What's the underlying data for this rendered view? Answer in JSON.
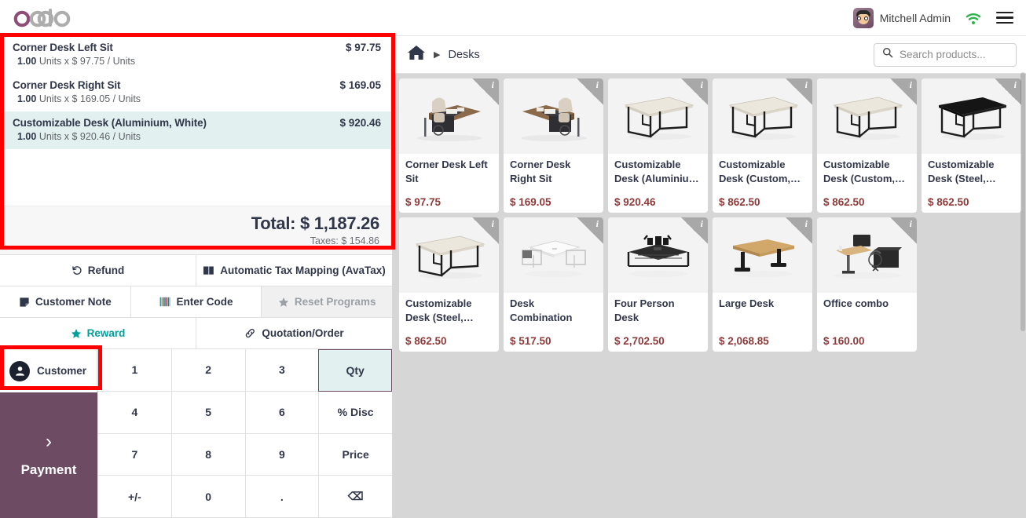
{
  "topbar": {
    "logo_text": "odoo",
    "user_name": "Mitchell Admin",
    "wifi_icon": "wifi-icon",
    "menu_icon": "hamburger-menu-icon",
    "avatar_name": "user-avatar"
  },
  "order": {
    "lines": [
      {
        "name": "Corner Desk Left Sit",
        "price": "$ 97.75",
        "qty": "1.00",
        "detail": "Units x $ 97.75 / Units",
        "selected": false
      },
      {
        "name": "Corner Desk Right Sit",
        "price": "$ 169.05",
        "qty": "1.00",
        "detail": "Units x $ 169.05 / Units",
        "selected": false
      },
      {
        "name": "Customizable Desk (Aluminium, White)",
        "price": "$ 920.46",
        "qty": "1.00",
        "detail": "Units x $ 920.46 / Units",
        "selected": true
      }
    ],
    "total_label": "Total: $ 1,187.26",
    "taxes_label": "Taxes: $ 154.86"
  },
  "controls": {
    "row1": [
      {
        "label": "Refund",
        "icon": "refund-undo-icon",
        "state": "enabled"
      },
      {
        "label": "Automatic Tax Mapping (AvaTax)",
        "icon": "book-icon",
        "state": "enabled"
      }
    ],
    "row2": [
      {
        "label": "Customer Note",
        "icon": "note-icon",
        "state": "enabled"
      },
      {
        "label": "Enter Code",
        "icon": "barcode-icon",
        "state": "enabled"
      },
      {
        "label": "Reset Programs",
        "icon": "star-icon",
        "state": "disabled"
      }
    ],
    "row3": [
      {
        "label": "Reward",
        "icon": "star-icon",
        "state": "teal"
      },
      {
        "label": "Quotation/Order",
        "icon": "link-icon",
        "state": "enabled"
      }
    ]
  },
  "customer_button": {
    "label": "Customer",
    "icon": "person-circle-icon"
  },
  "payment_button": {
    "label": "Payment",
    "icon": "chevron-right-icon"
  },
  "numpad": {
    "keys": [
      {
        "label": "1",
        "active": false
      },
      {
        "label": "2",
        "active": false
      },
      {
        "label": "3",
        "active": false
      },
      {
        "label": "Qty",
        "active": true
      },
      {
        "label": "4",
        "active": false
      },
      {
        "label": "5",
        "active": false
      },
      {
        "label": "6",
        "active": false
      },
      {
        "label": "% Disc",
        "active": false
      },
      {
        "label": "7",
        "active": false
      },
      {
        "label": "8",
        "active": false
      },
      {
        "label": "9",
        "active": false
      },
      {
        "label": "Price",
        "active": false
      },
      {
        "label": "+/-",
        "active": false
      },
      {
        "label": "0",
        "active": false
      },
      {
        "label": ".",
        "active": false
      },
      {
        "label": "⌫",
        "active": false
      }
    ]
  },
  "product_header": {
    "home_icon": "home-icon",
    "breadcrumb": "Desks",
    "search_icon": "search-icon",
    "search_placeholder": "Search products...",
    "search_value": ""
  },
  "products": [
    {
      "name": "Corner Desk Left Sit",
      "price": "$ 97.75",
      "img": "corner-desk-left",
      "info": "i"
    },
    {
      "name": "Corner Desk Right Sit",
      "price": "$ 169.05",
      "img": "corner-desk-right",
      "info": "i"
    },
    {
      "name": "Customizable Desk (Aluminiu…",
      "price": "$ 920.46",
      "img": "desk-white",
      "info": "i"
    },
    {
      "name": "Customizable Desk (Custom,…",
      "price": "$ 862.50",
      "img": "desk-white",
      "info": "i"
    },
    {
      "name": "Customizable Desk (Custom,…",
      "price": "$ 862.50",
      "img": "desk-white",
      "info": "i"
    },
    {
      "name": "Customizable Desk (Steel,…",
      "price": "$ 862.50",
      "img": "desk-black",
      "info": "i"
    },
    {
      "name": "Customizable Desk (Steel,…",
      "price": "$ 862.50",
      "img": "desk-white",
      "info": "i"
    },
    {
      "name": "Desk Combination",
      "price": "$ 517.50",
      "img": "desk-combination",
      "info": "i"
    },
    {
      "name": "Four Person Desk",
      "price": "$ 2,702.50",
      "img": "four-person-desk",
      "info": "i"
    },
    {
      "name": "Large Desk",
      "price": "$ 2,068.85",
      "img": "large-desk",
      "info": "i"
    },
    {
      "name": "Office combo",
      "price": "$ 160.00",
      "img": "office-combo",
      "info": "i"
    }
  ],
  "annotations": [
    {
      "name": "order-summary-highlight",
      "color": "#fe0000"
    },
    {
      "name": "customer-button-highlight",
      "color": "#fe0000"
    }
  ]
}
